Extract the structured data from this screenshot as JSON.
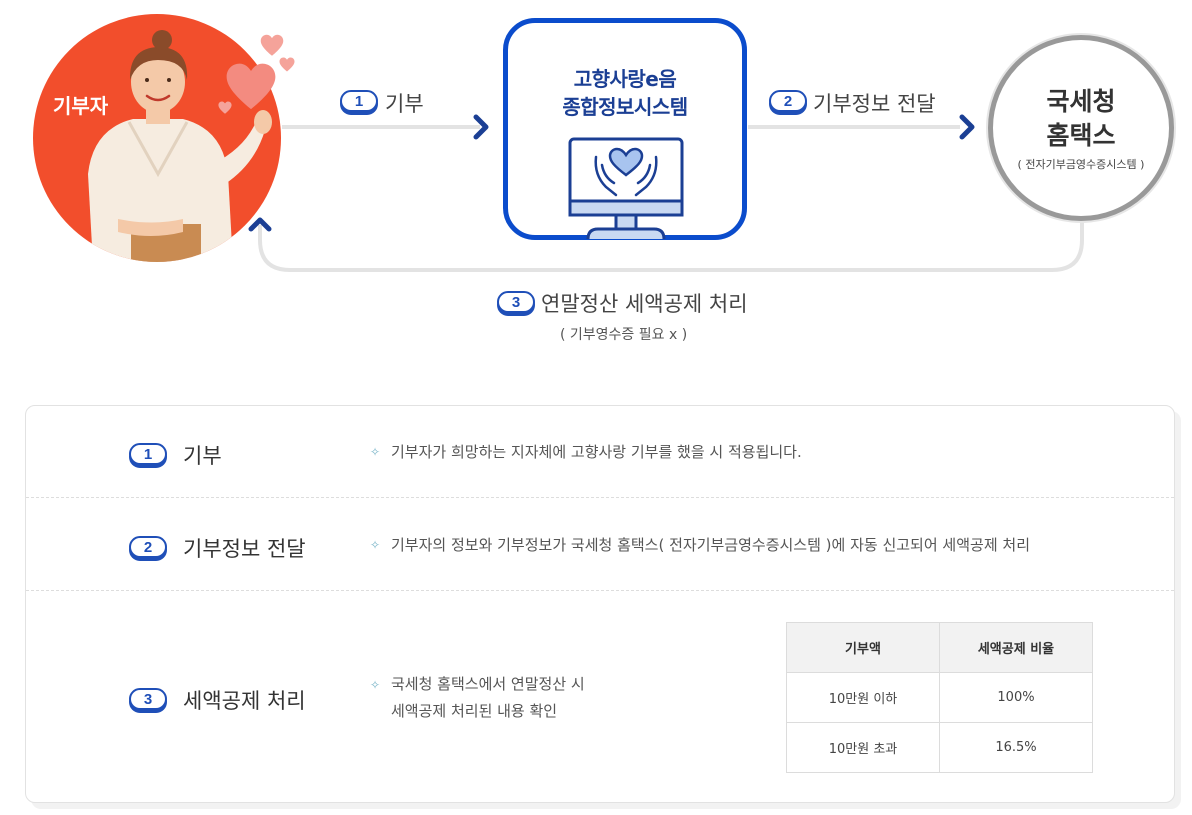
{
  "donor": {
    "label": "기부자"
  },
  "system": {
    "title_line1": "고향사랑e음",
    "title_line2": "종합정보시스템"
  },
  "nts": {
    "title_line1": "국세청",
    "title_line2": "홈택스",
    "subtitle": "( 전자기부금영수증시스템 )"
  },
  "flow": [
    {
      "number": "1",
      "label": "기부"
    },
    {
      "number": "2",
      "label": "기부정보 전달"
    },
    {
      "number": "3",
      "label": "연말정산 세액공제 처리",
      "note": "( 기부영수증 필요 x )"
    }
  ],
  "details": [
    {
      "number": "1",
      "title": "기부",
      "desc": "기부자가 희망하는 지자체에 고향사랑 기부를 했을 시 적용됩니다."
    },
    {
      "number": "2",
      "title": "기부정보 전달",
      "desc": "기부자의 정보와 기부정보가 국세청 홈택스( 전자기부금영수증시스템 )에 자동 신고되어 세액공제 처리"
    },
    {
      "number": "3",
      "title": "세액공제 처리",
      "desc_line1": "국세청 홈택스에서 연말정산 시",
      "desc_line2": "세액공제 처리된 내용 확인"
    }
  ],
  "deduction_table": {
    "headers": [
      "기부액",
      "세액공제 비율"
    ],
    "rows": [
      [
        "10만원 이하",
        "100%"
      ],
      [
        "10만원 초과",
        "16.5%"
      ]
    ]
  },
  "colors": {
    "accent_blue": "#0b4ccc",
    "donor_red": "#f24e2c",
    "line_gray": "#e3e3e3"
  },
  "icons": [
    "heart-icon",
    "hands-heart-icon",
    "monitor-icon",
    "arrow-right-icon",
    "arrow-up-icon",
    "leaf-bullet-icon"
  ]
}
